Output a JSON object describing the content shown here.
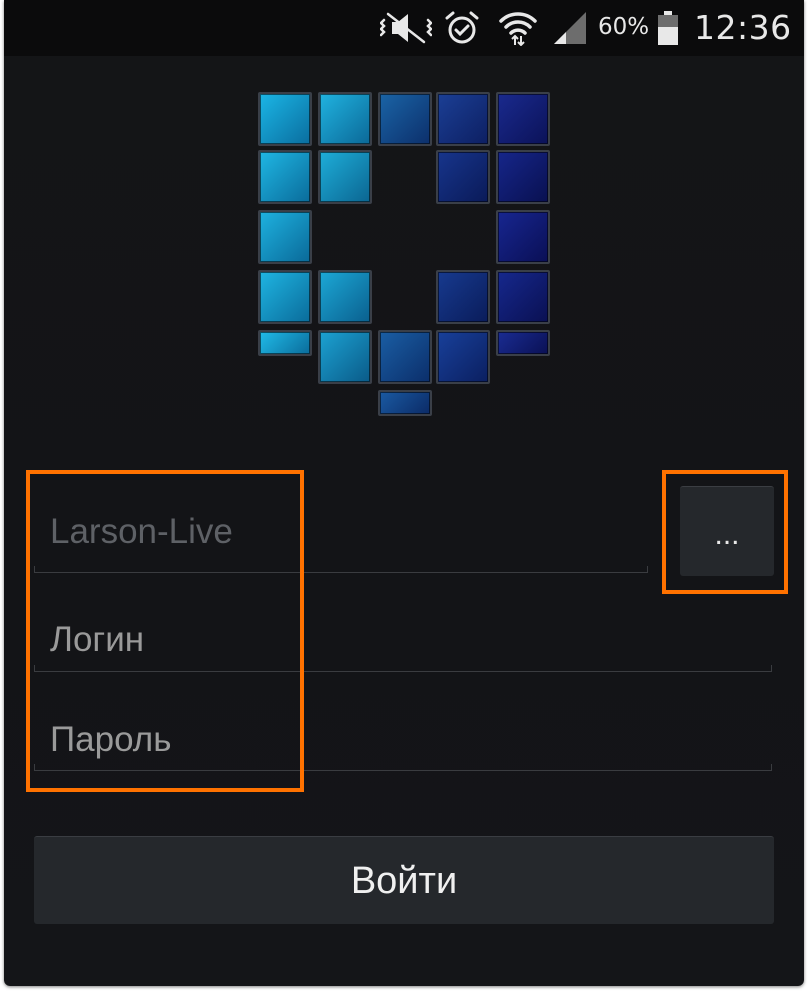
{
  "status_bar": {
    "battery_percent": "60%",
    "time": "12:36",
    "icons": [
      "mute-vibrate-icon",
      "alarm-icon",
      "wifi-icon",
      "signal-icon",
      "battery-icon"
    ]
  },
  "form": {
    "server_placeholder": "Larson-Live",
    "server_picker_label": "...",
    "login_placeholder": "Логин",
    "password_placeholder": "Пароль",
    "submit_label": "Войти"
  },
  "colors": {
    "background": "#131417",
    "button": "#25282c",
    "highlight": "#ff7200",
    "logo_cyan": "#1aa6d6",
    "logo_navy": "#0e1a6e"
  }
}
